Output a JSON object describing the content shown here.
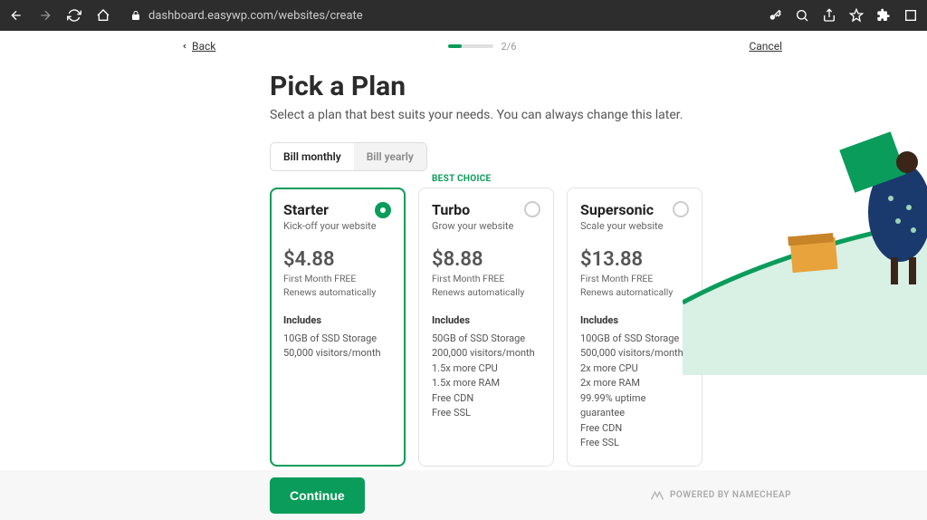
{
  "browser": {
    "url": "dashboard.easywp.com/websites/create"
  },
  "nav": {
    "back": "Back",
    "cancel": "Cancel",
    "progress": "2/6"
  },
  "header": {
    "title": "Pick a Plan",
    "subtitle": "Select a plan that best suits your needs. You can always change this later."
  },
  "billing": {
    "monthly": "Bill monthly",
    "yearly": "Bill yearly"
  },
  "plans": [
    {
      "name": "Starter",
      "tagline": "Kick-off your website",
      "price": "$4.88",
      "note1": "First Month FREE",
      "note2": "Renews automatically",
      "includes_title": "Includes",
      "includes": [
        "10GB of SSD Storage",
        "50,000 visitors/month"
      ],
      "selected": true
    },
    {
      "badge": "BEST CHOICE",
      "name": "Turbo",
      "tagline": "Grow your website",
      "price": "$8.88",
      "note1": "First Month FREE",
      "note2": "Renews automatically",
      "includes_title": "Includes",
      "includes": [
        "50GB of SSD Storage",
        "200,000 visitors/month",
        "1.5x more CPU",
        "1.5x more RAM",
        "Free CDN",
        "Free SSL"
      ],
      "selected": false
    },
    {
      "name": "Supersonic",
      "tagline": "Scale your website",
      "price": "$13.88",
      "note1": "First Month FREE",
      "note2": "Renews automatically",
      "includes_title": "Includes",
      "includes": [
        "100GB of SSD Storage",
        "500,000 visitors/months",
        "2x more CPU",
        "2x more RAM",
        "99.99% uptime guarantee",
        "Free CDN",
        "Free SSL"
      ],
      "selected": false
    }
  ],
  "footer": {
    "continue": "Continue",
    "powered": "POWERED BY NAMECHEAP"
  }
}
